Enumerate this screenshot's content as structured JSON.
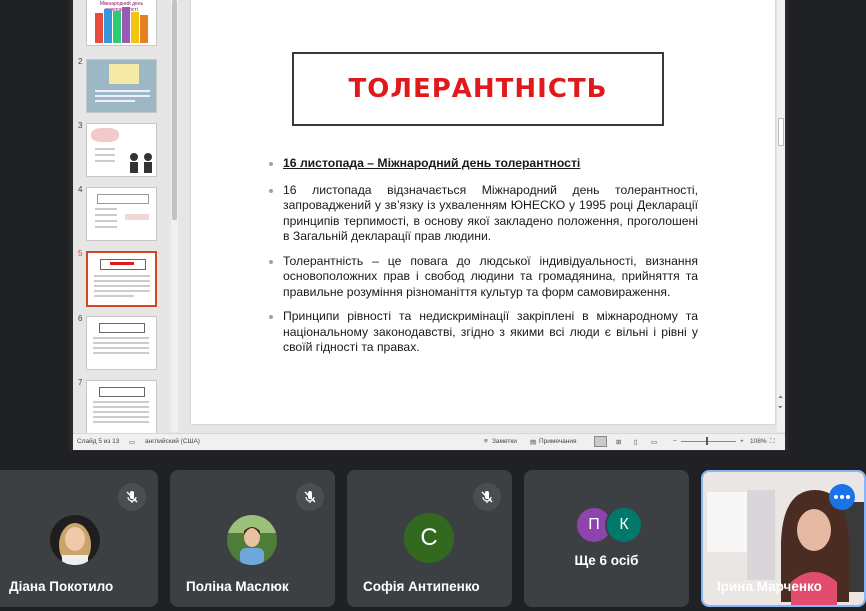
{
  "presentation": {
    "thumbnails": [
      {
        "num": "",
        "selected": false
      },
      {
        "num": "2",
        "selected": false
      },
      {
        "num": "3",
        "selected": false
      },
      {
        "num": "4",
        "selected": false
      },
      {
        "num": "5",
        "selected": true
      },
      {
        "num": "6",
        "selected": false
      },
      {
        "num": "7",
        "selected": false
      }
    ],
    "thumb1_caption": "Міжнародний день толерантності",
    "slide": {
      "title": "ТОЛЕРАНТНІСТЬ",
      "bullets": [
        "16 листопада – Міжнародний день толерантності",
        "16 листопада відзначається Міжнародний день толерантності, запроваджений у зв’язку із ухваленням ЮНЕСКО у 1995 році Декларації принципів терпимості, в основу якої закладено положення, проголошені в Загальній декларації прав людини.",
        "Толерантність – це повага до людської індивідуальності, визнання основоположних прав і свобод людини та громадянина, прийняття та правильне розуміння різноманіття культур та форм самовираження.",
        "Принципи рівності та недискримінації закріплені в міжнародному та національному законодавстві, згідно з якими всі люди є вільні і рівні у своїй гідності та правах."
      ]
    },
    "status": {
      "slide_info": "Слайд 5 из 13",
      "language": "английский (США)",
      "notes": "Заметки",
      "comments": "Примечания",
      "zoom": "108%"
    }
  },
  "participants": [
    {
      "name": "Діана Покотило",
      "muted": true
    },
    {
      "name": "Поліна Маслюк",
      "muted": true
    },
    {
      "name": "Софія Антипенко",
      "muted": true,
      "initial": "С",
      "color": "#33691e"
    },
    {
      "name": "Ще 6 осіб",
      "avatars": [
        {
          "initial": "П",
          "color": "#8e44ad"
        },
        {
          "initial": "К",
          "color": "#00796b"
        }
      ]
    },
    {
      "name": "Ірина Марченко",
      "active": true
    }
  ],
  "colors": {
    "accent": "#1a73e8",
    "title_red": "#e0191c",
    "selected_thumb": "#d24726"
  }
}
